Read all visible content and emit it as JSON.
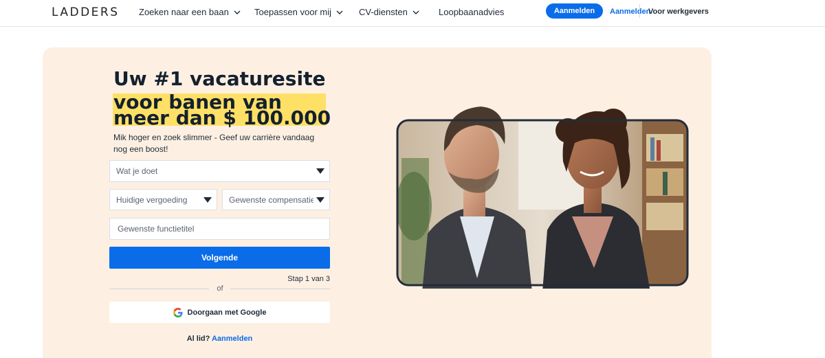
{
  "header": {
    "logo": "LADDERS",
    "nav": [
      {
        "label": "Zoeken naar een baan",
        "has_dropdown": true
      },
      {
        "label": "Toepassen voor mij",
        "has_dropdown": true
      },
      {
        "label": "CV-diensten",
        "has_dropdown": true
      },
      {
        "label": "Loopbaanadvies",
        "has_dropdown": false
      }
    ],
    "signin_button": "Aanmelden",
    "signin_link": "Aanmelden",
    "employers_link": "Voor werkgevers"
  },
  "hero": {
    "headline_line1": "Uw #1 vacaturesite",
    "headline_line2": "voor banen van",
    "headline_line3": "meer dan $ 100.000",
    "subtext": "Mik hoger en zoek slimmer - Geef uw carrière vandaag nog een boost!",
    "form": {
      "job_select": "Wat je doet",
      "current_comp_select": "Huidige vergoeding",
      "desired_comp_select": "Gewenste compensatie",
      "title_placeholder": "Gewenste functietitel",
      "next_button": "Volgende",
      "step_text": "Stap 1 van 3",
      "or_text": "of",
      "google_button": "Doorgaan met Google",
      "member_text": "Al lid?",
      "member_link": "Aanmelden"
    }
  },
  "colors": {
    "accent": "#0a6ce8",
    "hero_bg": "#fdf0e2",
    "highlight": "#ffe066",
    "text_dark": "#14202e"
  },
  "icons": [
    "chevron-down-icon",
    "caret-down-icon",
    "google-logo-icon"
  ]
}
